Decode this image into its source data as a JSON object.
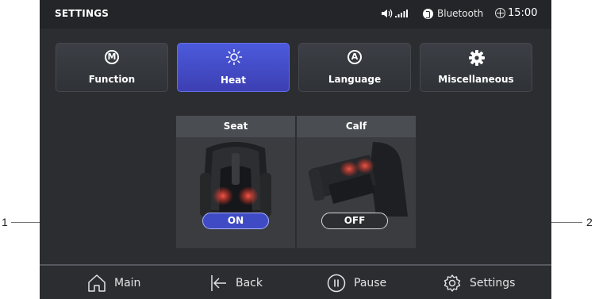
{
  "statusbar": {
    "title": "SETTINGS",
    "bluetooth_label": "Bluetooth",
    "time": "15:00"
  },
  "tabs": [
    {
      "label": "Function",
      "icon": "m-circle-icon",
      "active": false
    },
    {
      "label": "Heat",
      "icon": "sun-icon",
      "active": true
    },
    {
      "label": "Language",
      "icon": "a-circle-icon",
      "active": false
    },
    {
      "label": "Miscellaneous",
      "icon": "gear-icon",
      "active": false
    }
  ],
  "heat_zones": [
    {
      "label": "Seat",
      "state": "ON"
    },
    {
      "label": "Calf",
      "state": "OFF"
    }
  ],
  "nav": {
    "main": "Main",
    "back": "Back",
    "pause": "Pause",
    "settings": "Settings"
  },
  "callouts": [
    "1",
    "2"
  ],
  "colors": {
    "background": "#2b2d31",
    "accent": "#4b5adc",
    "text": "#ffffff"
  }
}
